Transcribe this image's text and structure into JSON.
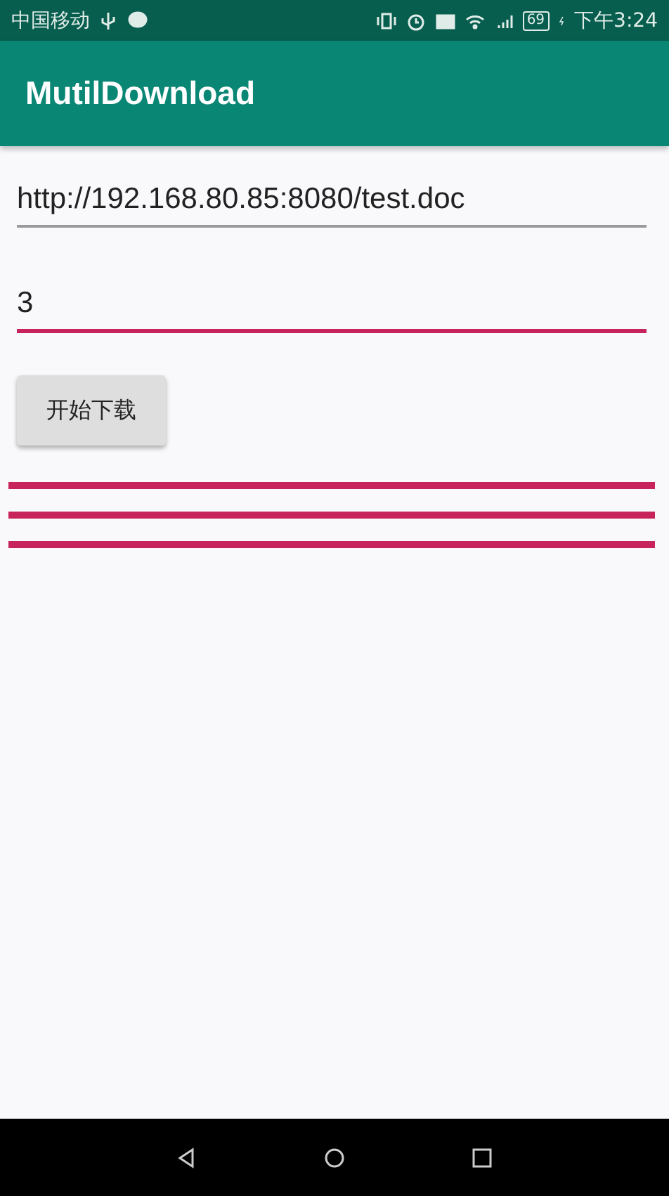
{
  "status_bar": {
    "carrier": "中国移动",
    "battery": "69",
    "time": "下午3:24"
  },
  "app_bar": {
    "title": "MutilDownload"
  },
  "fields": [
    {
      "value": "http://192.168.80.85:8080/test.doc",
      "focused": false
    },
    {
      "value": "3",
      "focused": true
    }
  ],
  "button": {
    "label": "开始下载"
  },
  "progress_bars": [
    {
      "level": 1
    },
    {
      "level": 1
    },
    {
      "level": 1
    }
  ]
}
